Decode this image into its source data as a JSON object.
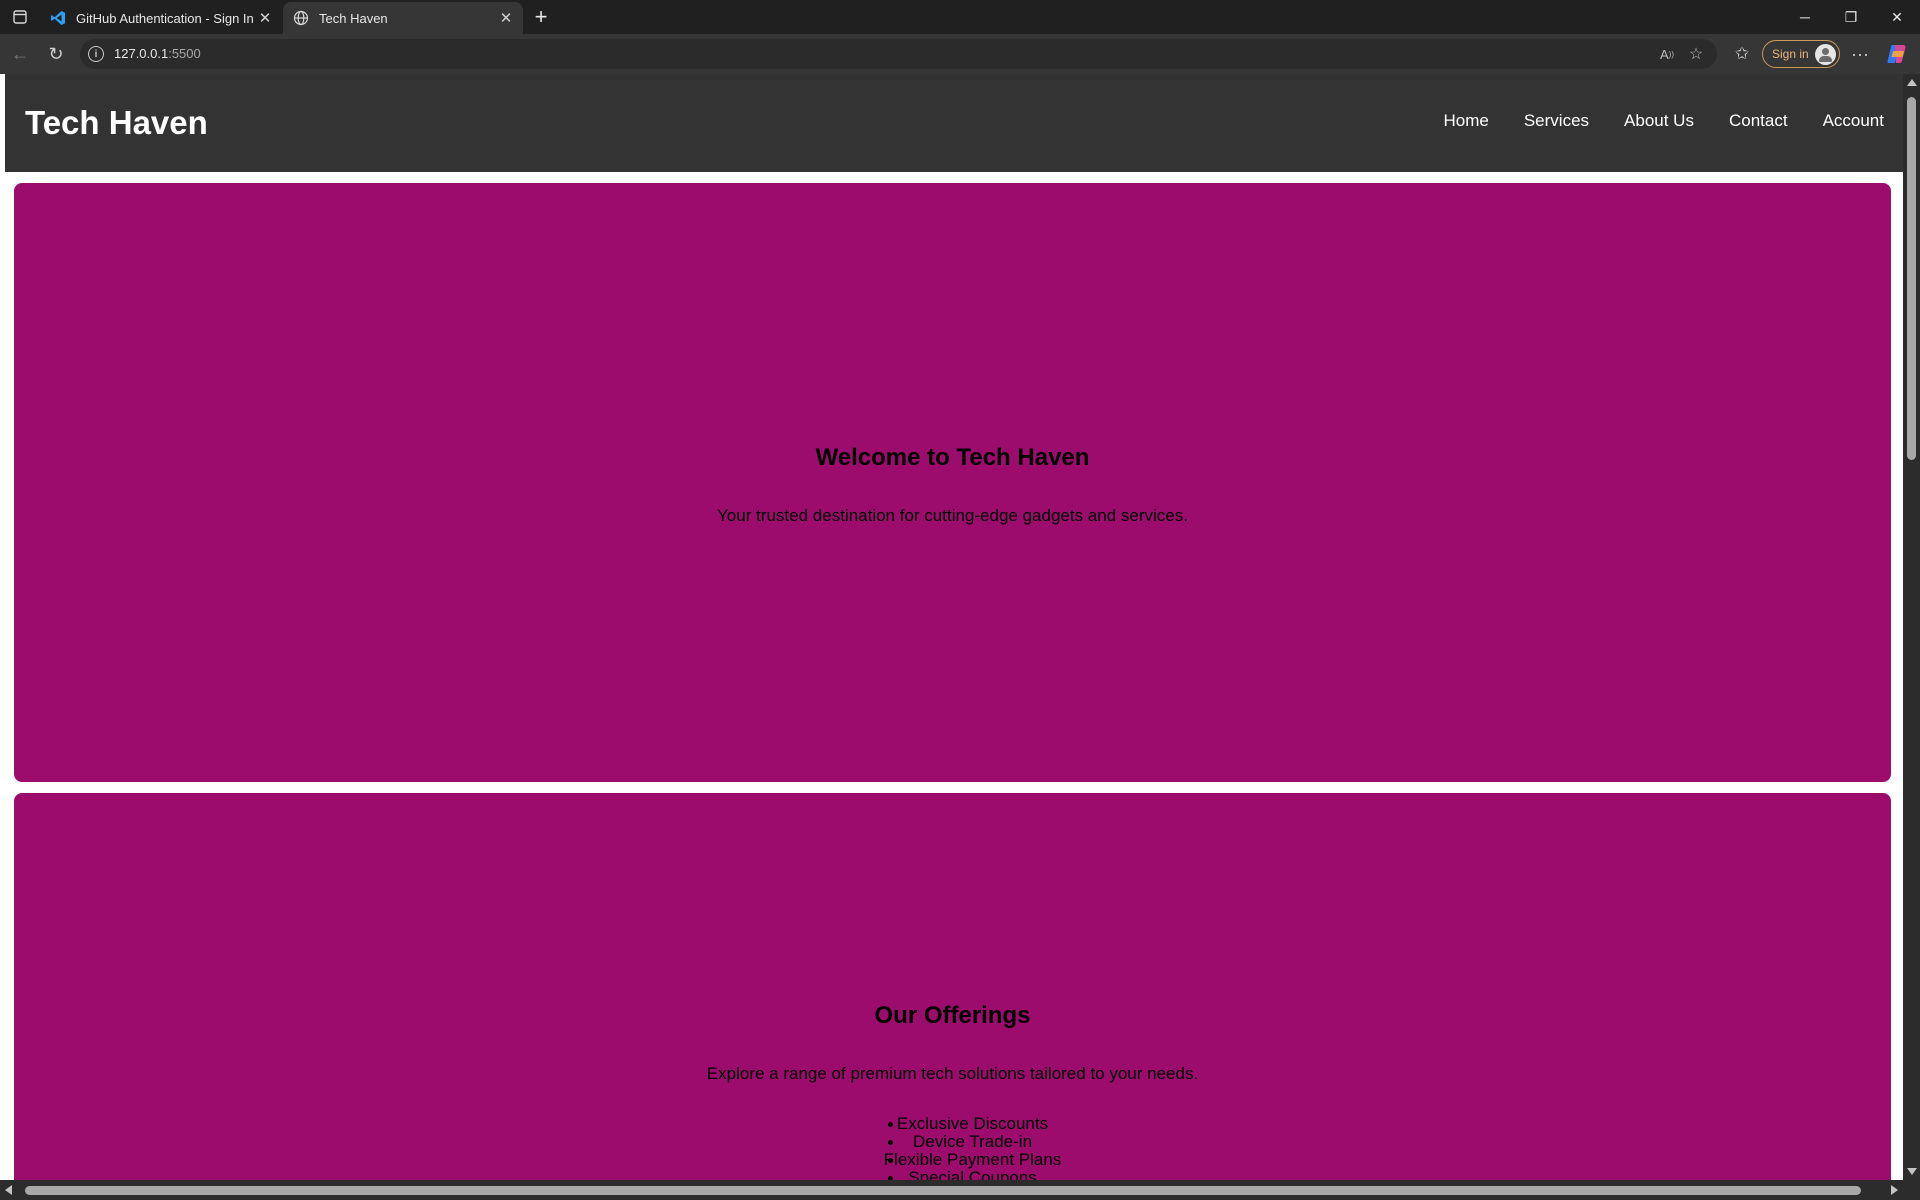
{
  "browser": {
    "tabs": [
      {
        "title": "GitHub Authentication - Sign In",
        "icon": "vscode-icon",
        "active": false
      },
      {
        "title": "Tech Haven",
        "icon": "globe-icon",
        "active": true
      }
    ],
    "address": {
      "host": "127.0.0.1",
      "port": ":5500"
    },
    "signin_label": "Sign in"
  },
  "site": {
    "logo": "Tech Haven",
    "nav": [
      "Home",
      "Services",
      "About Us",
      "Contact",
      "Account"
    ],
    "colors": {
      "header": "#333333",
      "section": "#9b0c6d"
    },
    "hero": {
      "title": "Welcome to Tech Haven",
      "subtitle": "Your trusted destination for cutting-edge gadgets and services."
    },
    "offerings": {
      "title": "Our Offerings",
      "subtitle": "Explore a range of premium tech solutions tailored to your needs.",
      "items": [
        "Exclusive Discounts",
        "Device Trade-in",
        "Flexible Payment Plans",
        "Special Coupons"
      ]
    }
  }
}
